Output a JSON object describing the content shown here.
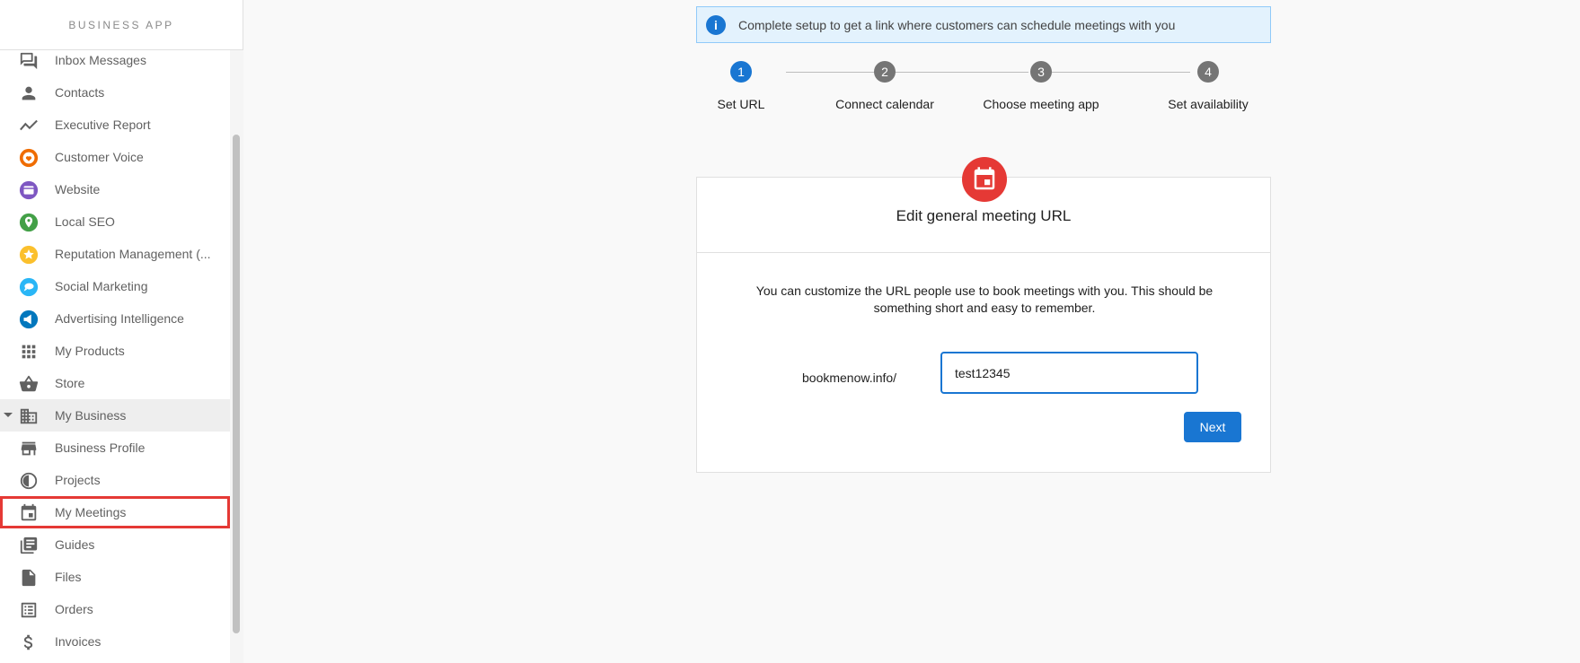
{
  "sidebar": {
    "brand": "BUSINESS APP",
    "items": [
      {
        "label": "Inbox Messages",
        "icon": "chat-icon"
      },
      {
        "label": "Contacts",
        "icon": "person-icon"
      },
      {
        "label": "Executive Report",
        "icon": "trend-icon"
      },
      {
        "label": "Customer Voice",
        "icon": "customer-voice-icon"
      },
      {
        "label": "Website",
        "icon": "website-icon"
      },
      {
        "label": "Local SEO",
        "icon": "local-seo-icon"
      },
      {
        "label": "Reputation Management (...",
        "icon": "reputation-icon"
      },
      {
        "label": "Social Marketing",
        "icon": "social-marketing-icon"
      },
      {
        "label": "Advertising Intelligence",
        "icon": "advertising-icon"
      },
      {
        "label": "My Products",
        "icon": "grid-icon"
      },
      {
        "label": "Store",
        "icon": "basket-icon"
      },
      {
        "label": "My Business",
        "icon": "building-icon"
      },
      {
        "label": "Business Profile",
        "icon": "storefront-icon"
      },
      {
        "label": "Projects",
        "icon": "projects-icon"
      },
      {
        "label": "My Meetings",
        "icon": "calendar-icon"
      },
      {
        "label": "Guides",
        "icon": "guides-icon"
      },
      {
        "label": "Files",
        "icon": "file-icon"
      },
      {
        "label": "Orders",
        "icon": "orders-icon"
      },
      {
        "label": "Invoices",
        "icon": "dollar-icon"
      }
    ]
  },
  "banner": {
    "text": "Complete setup to get a link where customers can schedule meetings with you"
  },
  "stepper": {
    "steps": [
      {
        "num": "1",
        "label": "Set URL"
      },
      {
        "num": "2",
        "label": "Connect calendar"
      },
      {
        "num": "3",
        "label": "Choose meeting app"
      },
      {
        "num": "4",
        "label": "Set availability"
      }
    ],
    "active_step": 1
  },
  "card": {
    "title": "Edit general meeting URL",
    "description": "You can customize the URL people use to book meetings with you. This should be something short and easy to remember.",
    "url_prefix": "bookmenow.info/",
    "url_value": "test12345",
    "next_label": "Next"
  },
  "colors": {
    "primary": "#1976d2",
    "badge_red": "#e53935",
    "banner_bg": "#e3f2fd"
  }
}
